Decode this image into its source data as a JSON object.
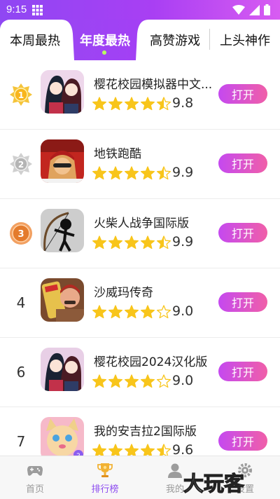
{
  "status_bar": {
    "time": "9:15"
  },
  "tabs": [
    {
      "label": "本周最热",
      "active": false
    },
    {
      "label": "年度最热",
      "active": true
    },
    {
      "label": "高赞游戏",
      "active": false
    },
    {
      "label": "上头神作",
      "active": false
    }
  ],
  "colors": {
    "header_start": "#8f47f3",
    "header_end": "#d85cf2",
    "star": "#f8c51b",
    "button": "#d94fd2",
    "active_nav": "#8d4cf0"
  },
  "apps": [
    {
      "rank": "1",
      "rank_style": "gold-medal",
      "name": "樱花校园模拟器中文...",
      "rating": 4.5,
      "score": "9.8",
      "button": "打开",
      "icon": "sakura-school-icon"
    },
    {
      "rank": "2",
      "rank_style": "silver-medal",
      "name": "地铁跑酷",
      "rating": 4.5,
      "score": "9.9",
      "button": "打开",
      "icon": "subway-surfers-icon"
    },
    {
      "rank": "3",
      "rank_style": "bronze-medal",
      "name": "火柴人战争国际版",
      "rating": 4.5,
      "score": "9.9",
      "button": "打开",
      "icon": "stick-war-icon"
    },
    {
      "rank": "4",
      "rank_style": "number",
      "name": "沙威玛传奇",
      "rating": 4,
      "score": "9.0",
      "button": "打开",
      "icon": "shawarma-icon"
    },
    {
      "rank": "6",
      "rank_style": "number",
      "name": "樱花校园2024汉化版",
      "rating": 4,
      "score": "9.0",
      "button": "打开",
      "icon": "sakura-school-icon"
    },
    {
      "rank": "7",
      "rank_style": "number",
      "name": "我的安吉拉2国际版",
      "rating": 4.5,
      "score": "9.6",
      "button": "打开",
      "icon": "talking-angela-icon"
    }
  ],
  "bottom_nav": [
    {
      "label": "首页",
      "icon": "gamepad-icon",
      "active": false
    },
    {
      "label": "排行榜",
      "icon": "trophy-icon",
      "active": true
    },
    {
      "label": "我的",
      "icon": "user-icon",
      "active": false
    },
    {
      "label": "设置",
      "icon": "settings-icon",
      "active": false
    }
  ],
  "watermark": "大玩客"
}
